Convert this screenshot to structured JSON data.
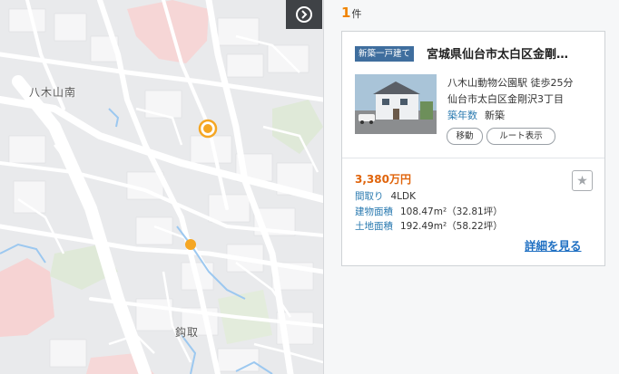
{
  "map": {
    "labels": {
      "yagiyama_minami": "八木山南",
      "kanetori": "鈎取"
    },
    "toggle_icon": "chevron-right-circle-icon",
    "colors": {
      "road": "#ffffff",
      "land": "#e9eaec",
      "block": "#f7f7f8",
      "water": "#9cc8f0",
      "green": "#d6e6cf",
      "pink_zone": "#f6d3d3",
      "marker": "#f5a623"
    }
  },
  "results": {
    "count": "1",
    "count_unit": "件"
  },
  "listing": {
    "tag": "新築一戸建て",
    "title": "宮城県仙台市太白区金剛…",
    "station": "八木山動物公園駅 徒歩25分",
    "address": "仙台市太白区金剛沢3丁目",
    "age_label": "築年数",
    "age_value": "新築",
    "move_button": "移動",
    "route_button": "ルート表示",
    "price": "3,380万円",
    "layout_label": "間取り",
    "layout_value": "4LDK",
    "building_area_label": "建物面積",
    "building_area_value": "108.47m²（32.81坪）",
    "land_area_label": "土地面積",
    "land_area_value": "192.49m²（58.22坪）",
    "favorite_icon": "star-icon",
    "detail_link": "詳細を見る",
    "colors": {
      "tag_bg": "#3f6e9e",
      "price": "#e0640b",
      "label": "#2a7ab0",
      "link": "#1e6fc2",
      "count": "#f08300"
    }
  }
}
